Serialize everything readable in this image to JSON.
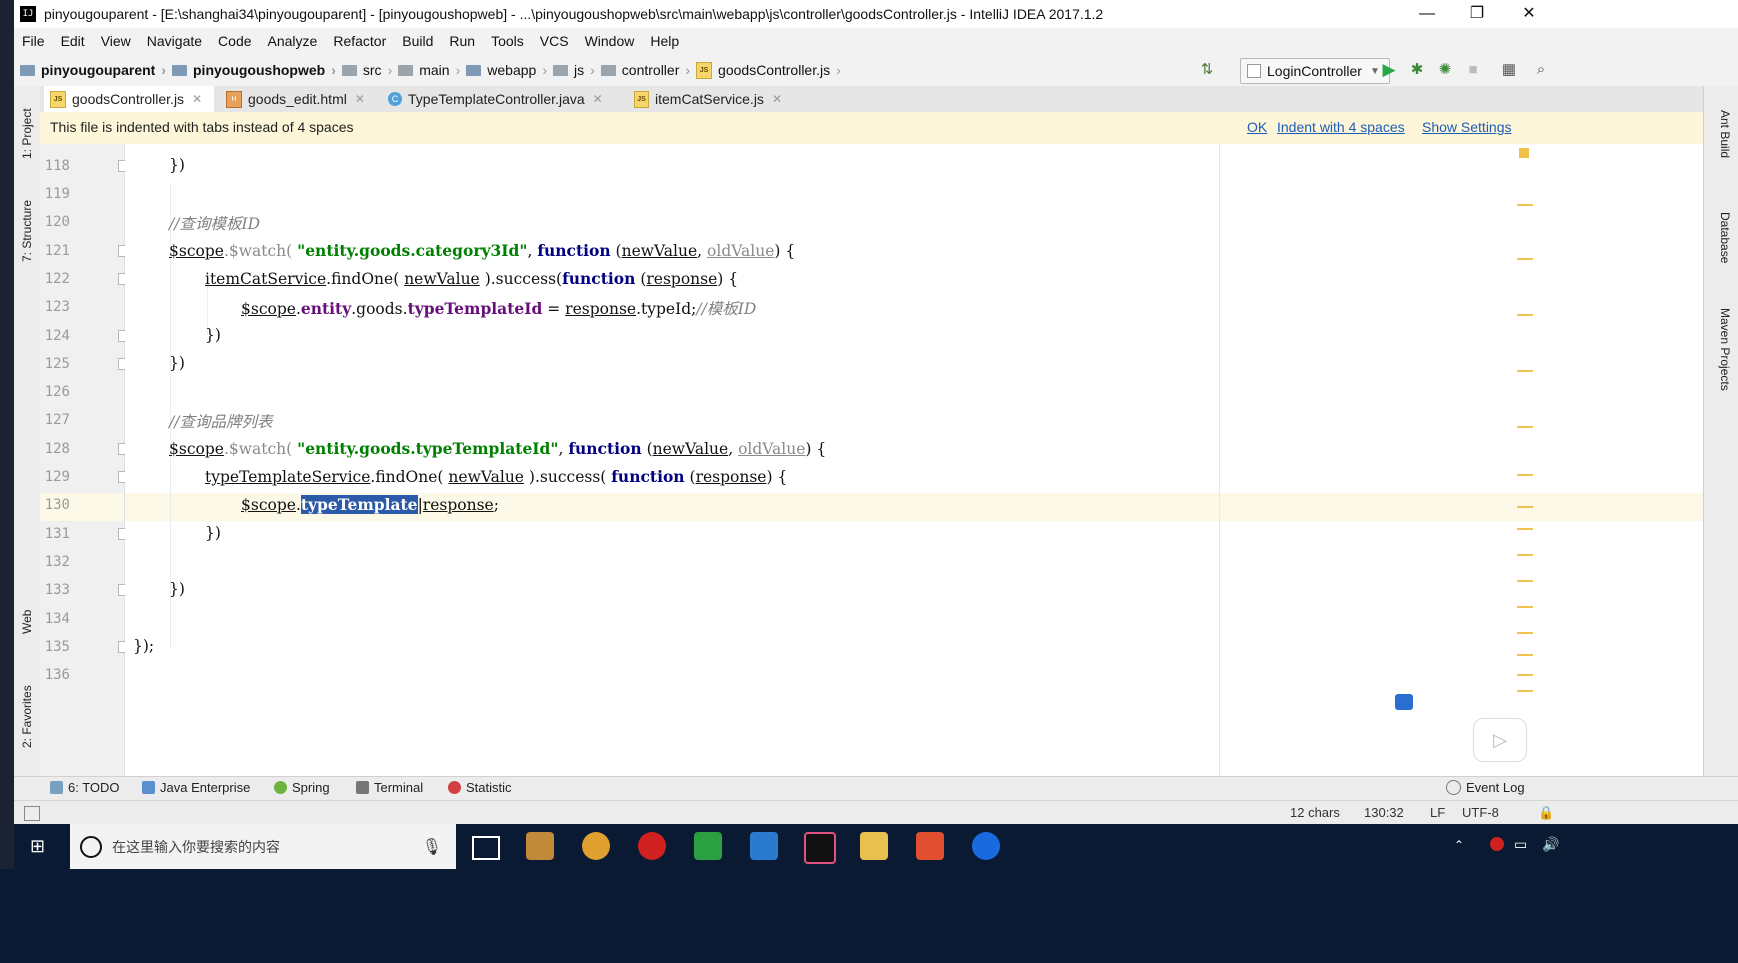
{
  "window": {
    "title": "pinyougouparent - [E:\\shanghai34\\pinyougouparent] - [pinyougoushopweb] - ...\\pinyougoushopweb\\src\\main\\webapp\\js\\controller\\goodsController.js - IntelliJ IDEA 2017.1.2",
    "app_icon": "IJ",
    "minimize": "—",
    "restore": "❐",
    "close": "✕"
  },
  "menu": [
    "File",
    "Edit",
    "View",
    "Navigate",
    "Code",
    "Analyze",
    "Refactor",
    "Build",
    "Run",
    "Tools",
    "VCS",
    "Window",
    "Help"
  ],
  "breadcrumbs": [
    "pinyougouparent",
    "pinyougoushopweb",
    "src",
    "main",
    "webapp",
    "js",
    "controller",
    "goodsController.js"
  ],
  "run_config": "LoginController",
  "tabs": [
    {
      "label": "goodsController.js",
      "icon": "js-file-icon"
    },
    {
      "label": "goods_edit.html",
      "icon": "html-file-icon"
    },
    {
      "label": "TypeTemplateController.java",
      "icon": "java-class-icon"
    },
    {
      "label": "itemCatService.js",
      "icon": "js-file-icon"
    }
  ],
  "notice": {
    "message": "This file is indented with tabs instead of 4 spaces",
    "ok": "OK",
    "indent": "Indent with 4 spaces",
    "settings": "Show Settings"
  },
  "line_numbers": [
    "118",
    "119",
    "120",
    "121",
    "122",
    "123",
    "124",
    "125",
    "126",
    "127",
    "128",
    "129",
    "130",
    "131",
    "132",
    "133",
    "134",
    "135",
    "136"
  ],
  "code": {
    "l118": "})",
    "l120_comment": "//查询模板ID",
    "l121_scope": "$scope",
    "l121_watch": ".$watch(",
    "l121_str": "\"entity.goods.category3Id\"",
    "l121_fn": "function",
    "l121_nv": "newValue",
    "l121_ov": "oldValue",
    "l121_end": ") {",
    "l122_svc": "itemCatService",
    "l122_call": ".findOne(",
    "l122_nv": "newValue",
    "l122_succ": ").success(",
    "l122_fn": "function",
    "l122_resp": "response",
    "l122_end": ") {",
    "l123_scope": "$scope",
    "l123_entity": "entity",
    "l123_goods": ".goods.",
    "l123_ttid": "typeTemplateId",
    "l123_eq": " = ",
    "l123_resp": "response",
    "l123_tail": ".typeId;",
    "l123_comment": "//模板ID",
    "l124": "})",
    "l125": "})",
    "l127_comment": "//查询品牌列表",
    "l128_scope": "$scope",
    "l128_watch": ".$watch(",
    "l128_str": "\"entity.goods.typeTemplateId\"",
    "l128_fn": "function",
    "l128_nv": "newValue",
    "l128_ov": "oldValue",
    "l128_end": ") {",
    "l129_svc": "typeTemplateService",
    "l129_call": ".findOne(",
    "l129_nv": "newValue",
    "l129_succ": ").success(",
    "l129_fn": "function",
    "l129_resp": "response",
    "l129_end": ") {",
    "l130_scope": "$scope",
    "l130_sel": "typeTemplate",
    "l130_resp": "response",
    "l130_end": ";",
    "l131": "})",
    "l133": "})",
    "l135": "});"
  },
  "left_tools": [
    "1: Project",
    "7: Structure",
    "Web",
    "2: Favorites"
  ],
  "right_tools": [
    "Ant Build",
    "Database",
    "Maven Projects"
  ],
  "bottom_tools": [
    "6: TODO",
    "Java Enterprise",
    "Spring",
    "Terminal",
    "Statistic"
  ],
  "event_log": "Event Log",
  "status": {
    "chars": "12 chars",
    "position": "130:32",
    "line_sep": "LF",
    "encoding": "UTF-8"
  },
  "taskbar": {
    "search_placeholder": "在这里输入你要搜索的内容"
  },
  "colors": {
    "accent": "#2a5aa8",
    "notice_bg": "#fdf6d9",
    "string": "#008000",
    "keyword": "#000080"
  }
}
